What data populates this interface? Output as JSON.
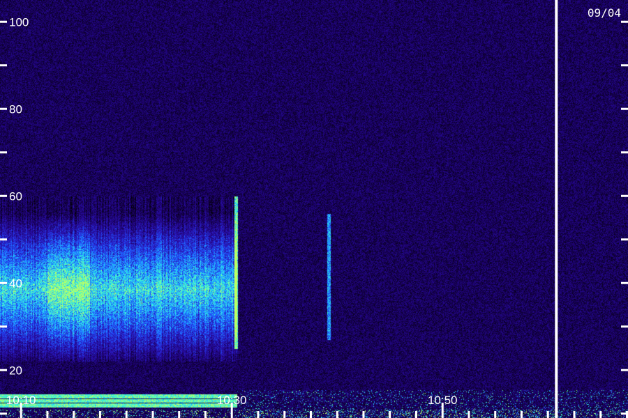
{
  "date_label": "09/04",
  "chart_data": {
    "type": "heatmap",
    "title": "",
    "xlabel": "",
    "ylabel": "",
    "y_tick_labels": [
      "20",
      "40",
      "60",
      "80",
      "100"
    ],
    "y_ticks": [
      10,
      20,
      30,
      40,
      50,
      60,
      70,
      80,
      90,
      100
    ],
    "ylim": [
      9,
      105
    ],
    "x_tick_labels": [
      "10:10",
      "10:30",
      "10:50"
    ],
    "x_label_minutes": [
      10,
      30,
      50
    ],
    "xlim_minutes": [
      8.0,
      67.6
    ],
    "x_major_tick_minutes": [
      10,
      30,
      50
    ],
    "x_minor_tick_interval_minutes": 2.5,
    "time_marker_minute": 60.8,
    "colormap": [
      "#000000",
      "#1a0060",
      "#2a10b0",
      "#2050ff",
      "#20c0ff",
      "#40ffd0",
      "#c0ff60"
    ],
    "colors": {
      "background": "#000000",
      "axis_text": "#ffffff",
      "marker_line": "#ffffff",
      "noise": "#2a0c8a",
      "signal": "#2050ff",
      "signal_peak": "#3fe8ff"
    },
    "features": [
      {
        "name": "broadband-emission",
        "start_minute": 8.0,
        "end_minute": 30.5,
        "y_low": 25,
        "y_high": 60,
        "intensity": 0.7
      },
      {
        "name": "low-band-lines",
        "y_values": [
          12,
          13,
          14
        ],
        "start_minute": 8.0,
        "end_minute": 30.5,
        "intensity": 1.0
      },
      {
        "name": "streak",
        "minute": 30.4,
        "y_low": 25,
        "y_high": 60,
        "intensity": 0.9
      },
      {
        "name": "streak",
        "minute": 39.2,
        "y_low": 27,
        "y_high": 56,
        "intensity": 0.6
      }
    ],
    "grid": false,
    "legend": "none"
  }
}
